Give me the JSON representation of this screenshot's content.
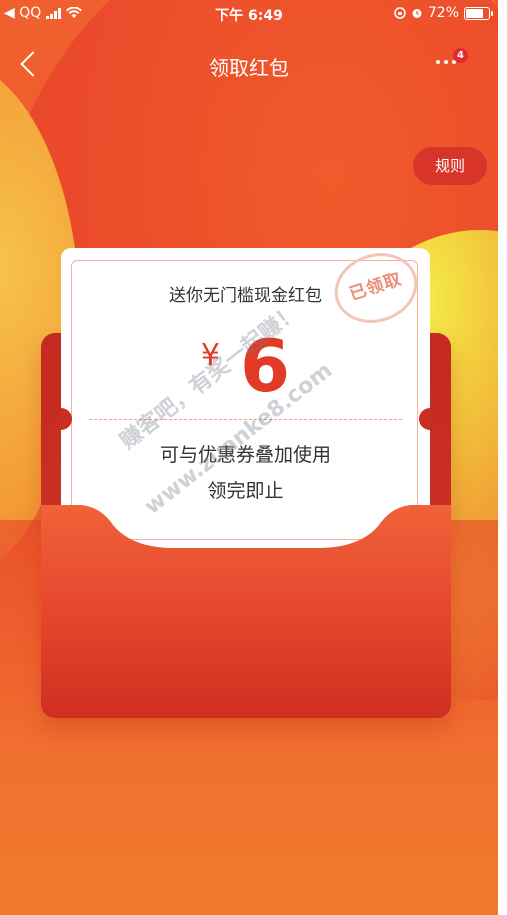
{
  "status_bar": {
    "carrier": "◀ QQ",
    "time": "下午 6:49",
    "battery_percent": "72%",
    "battery_level": 0.72
  },
  "nav": {
    "title": "领取红包",
    "more_badge": "4"
  },
  "rules_button": "规则",
  "card": {
    "title": "送你无门槛现金红包",
    "currency": "¥",
    "amount": "6",
    "stamp": "已领取",
    "desc_line1": "可与优惠券叠加使用",
    "desc_line2": "领完即止"
  },
  "watermark": {
    "line1": "赚客吧，有奖一起赚！",
    "line2": "www.zuanke8.com"
  },
  "colors": {
    "accent": "#e23b25",
    "envelope": "#cf3424",
    "rules_bg": "#d8342a"
  },
  "icons": [
    "back-icon",
    "more-icon",
    "signal-icon",
    "wifi-icon",
    "alarm-icon",
    "lock-rotation-icon",
    "battery-icon"
  ]
}
